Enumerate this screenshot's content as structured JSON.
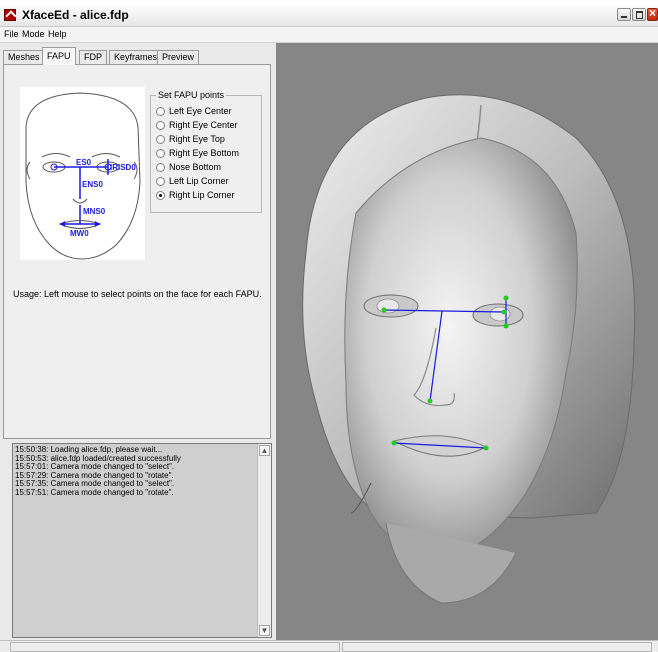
{
  "window": {
    "title": "XfaceEd - alice.fdp"
  },
  "menu": {
    "file": "File",
    "mode": "Mode",
    "help": "Help"
  },
  "tabs": [
    "Meshes",
    "FAPU",
    "FDP",
    "Keyframes",
    "Preview"
  ],
  "active_tab": "FAPU",
  "diagram": {
    "labels": [
      "ES0",
      "IRISD0",
      "ENS0",
      "MNS0",
      "MW0"
    ]
  },
  "fapu": {
    "legend": "Set FAPU points",
    "options": [
      "Left Eye Center",
      "Right Eye Center",
      "Right Eye Top",
      "Right Eye Bottom",
      "Nose Bottom",
      "Left Lip Corner",
      "Right Lip Corner"
    ],
    "selected": "Right Lip Corner"
  },
  "usage": "Usage: Left mouse to select points on the face for each FAPU.",
  "log": [
    "15:50:38: Loading alice.fdp, please wait...",
    "15:50:53: alice.fdp loaded/created successfully",
    "15:57:01: Camera mode changed to \"select\".",
    "15:57:29: Camera mode changed to \"rotate\".",
    "15:57:35: Camera mode changed to \"select\".",
    "15:57:51: Camera mode changed to \"rotate\"."
  ],
  "colors": {
    "viewport_bg": "#868686",
    "marker": "#22cc22",
    "fapu_line": "#1a1ae0"
  }
}
